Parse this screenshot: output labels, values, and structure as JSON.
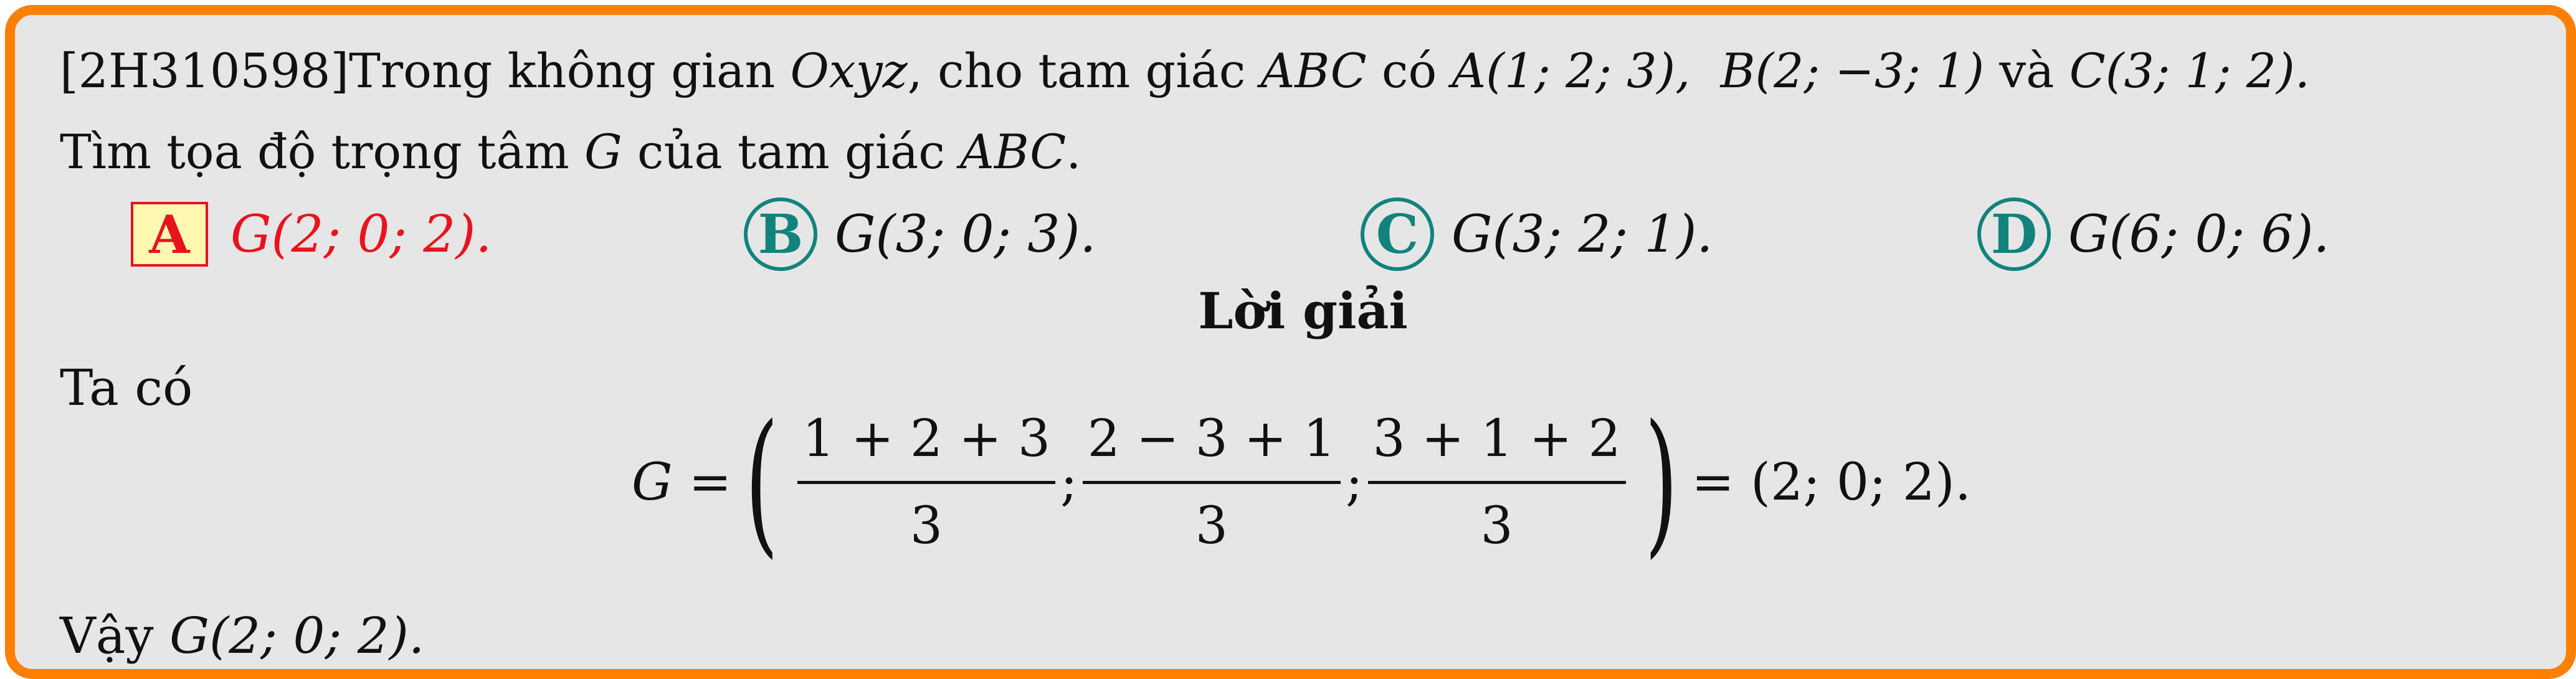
{
  "question": {
    "code": "[2H310598]",
    "intro": "Trong không gian ",
    "space": "Oxyz",
    "mid": ", cho tam giác ",
    "triangle": "ABC",
    "has": " có ",
    "point_a": "A(1; 2; 3),",
    "point_b": "B(2; −3; 1)",
    "and": " và ",
    "point_c": "C(3; 1; 2).",
    "prompt_start": "Tìm tọa độ trọng tâm ",
    "centroid": "G",
    "prompt_end": " của tam giác ",
    "prompt_triangle": "ABC",
    "prompt_period": "."
  },
  "options": [
    {
      "letter": "A",
      "text": "G(2; 0; 2)."
    },
    {
      "letter": "B",
      "text": "G(3; 0; 3)."
    },
    {
      "letter": "C",
      "text": "G(3; 2; 1)."
    },
    {
      "letter": "D",
      "text": "G(6; 0; 6)."
    }
  ],
  "solution": {
    "title": "Lời giải",
    "intro": "Ta có",
    "lhs": "G = ",
    "frac1_num": "1 + 2 + 3",
    "frac2_num": "2 − 3 + 1",
    "frac3_num": "3 + 1 + 2",
    "den": "3",
    "sep": ";",
    "rhs": " = (2; 0; 2).",
    "conclusion_text": "Vậy ",
    "conclusion_math": "G(2; 0; 2)."
  },
  "colors": {
    "border": "#ff7f00",
    "correct": "#e8141d",
    "option_circle": "#11837c",
    "background": "#e6e6e6"
  }
}
